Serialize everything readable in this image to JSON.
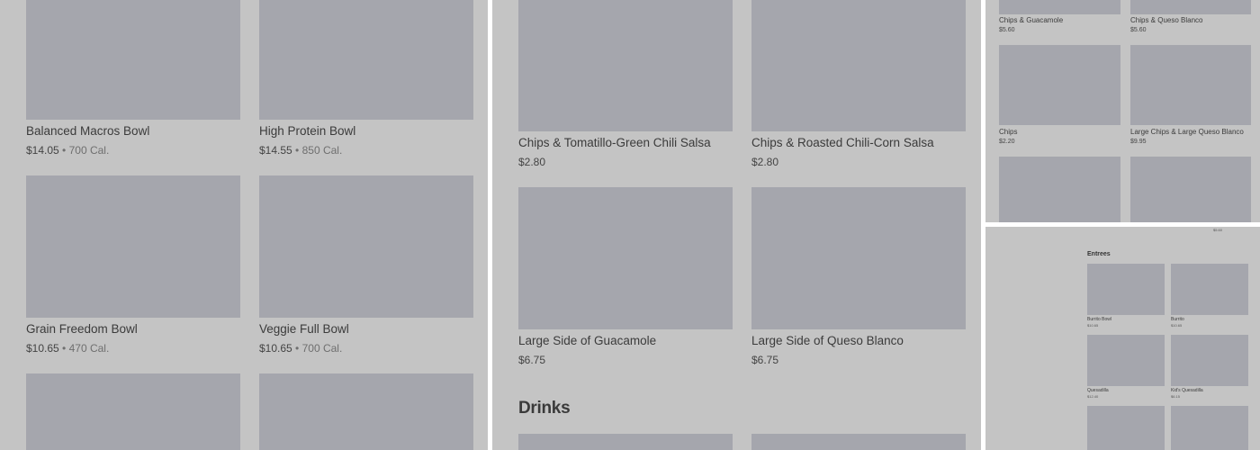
{
  "panel1": {
    "items": [
      {
        "name": "Balanced Macros Bowl",
        "price": "$14.05",
        "sep": "•",
        "calories": "700 Cal."
      },
      {
        "name": "High Protein Bowl",
        "price": "$14.55",
        "sep": "•",
        "calories": "850 Cal."
      },
      {
        "name": "Grain Freedom Bowl",
        "price": "$10.65",
        "sep": "•",
        "calories": "470 Cal."
      },
      {
        "name": "Veggie Full Bowl",
        "price": "$10.65",
        "sep": "•",
        "calories": "700 Cal."
      }
    ]
  },
  "panel2": {
    "items": [
      {
        "name": "Chips & Tomatillo-Green Chili Salsa",
        "price": "$2.80"
      },
      {
        "name": "Chips & Roasted Chili-Corn Salsa",
        "price": "$2.80"
      },
      {
        "name": "Large Side of Guacamole",
        "price": "$6.75"
      },
      {
        "name": "Large Side of Queso Blanco",
        "price": "$6.75"
      }
    ],
    "section_title": "Drinks"
  },
  "panel3": {
    "items": [
      {
        "name": "Chips & Guacamole",
        "price": "$5.60"
      },
      {
        "name": "Chips & Queso Blanco",
        "price": "$5.60"
      },
      {
        "name": "Chips",
        "price": "$2.20"
      },
      {
        "name": "Large Chips & Large Queso Blanco",
        "price": "$9.95"
      }
    ]
  },
  "panel4": {
    "stray_price": "$5.60",
    "section_title": "Entrees",
    "items": [
      {
        "name": "Burrito Bowl",
        "price": "$10.65"
      },
      {
        "name": "Burrito",
        "price": "$10.65"
      },
      {
        "name": "Quesadilla",
        "price": "$12.40"
      },
      {
        "name": "Kid's Quesadilla",
        "price": "$6.15"
      }
    ]
  }
}
